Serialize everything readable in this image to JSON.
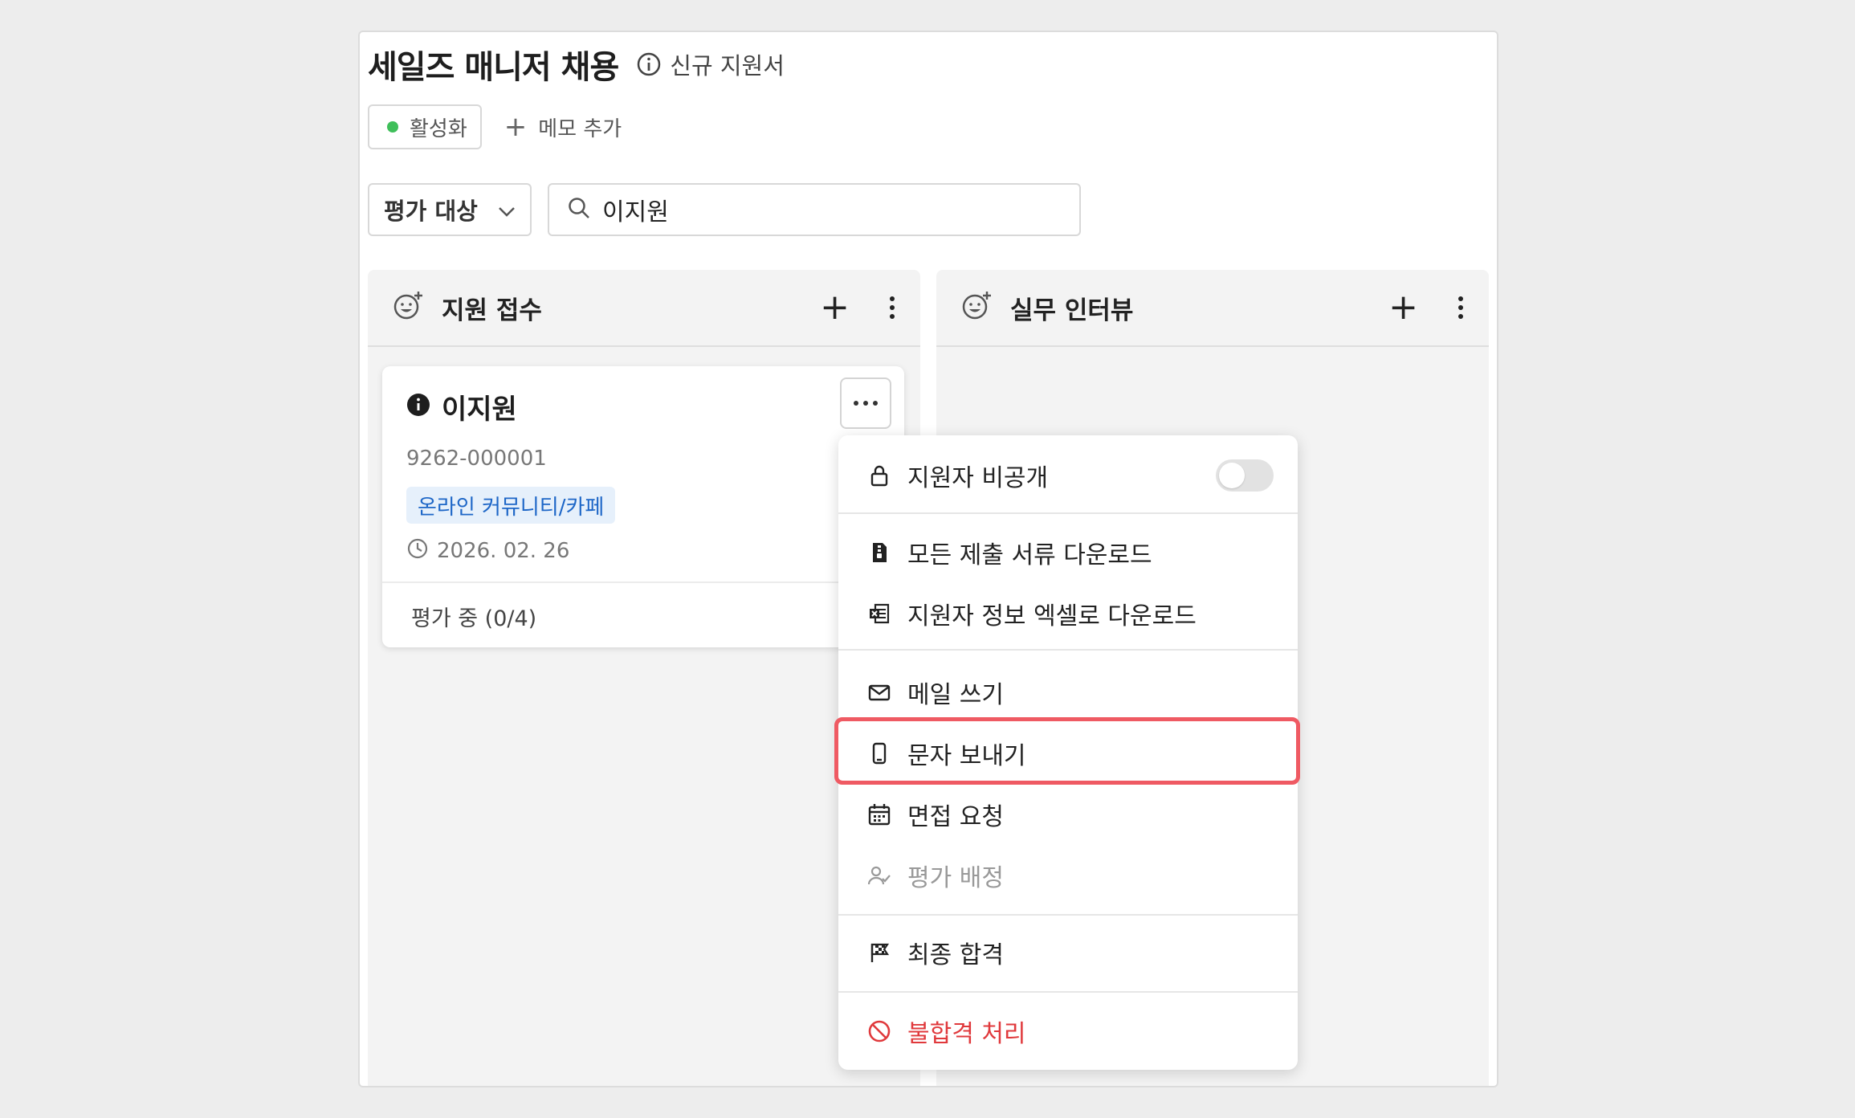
{
  "header": {
    "title": "세일즈 매니저 채용",
    "subtitle": "신규 지원서"
  },
  "status": {
    "label": "활성화",
    "color": "#3fbf5a"
  },
  "memo": {
    "label": "메모 추가"
  },
  "filter": {
    "selected": "평가 대상"
  },
  "search": {
    "value": "이지원"
  },
  "columns": [
    {
      "title": "지원 접수",
      "icon": "smile-plus-icon"
    },
    {
      "title": "실무 인터뷰",
      "icon": "smile-plus-icon"
    }
  ],
  "card": {
    "name": "이지원",
    "id": "9262-000001",
    "source": "온라인 커뮤니티/카페",
    "date": "2026. 02. 26",
    "progress": "평가 중 (0/4)"
  },
  "menu": {
    "items": [
      {
        "label": "지원자 비공개",
        "icon": "lock-icon"
      },
      {
        "label": "모든 제출 서류 다운로드",
        "icon": "file-zip-icon"
      },
      {
        "label": "지원자 정보 엑셀로 다운로드",
        "icon": "excel-icon"
      },
      {
        "label": "메일 쓰기",
        "icon": "mail-icon"
      },
      {
        "label": "문자 보내기",
        "icon": "phone-icon"
      },
      {
        "label": "면접 요청",
        "icon": "calendar-icon"
      },
      {
        "label": "평가 배정",
        "icon": "user-check-icon"
      },
      {
        "label": "최종 합격",
        "icon": "flag-icon"
      },
      {
        "label": "불합격 처리",
        "icon": "ban-icon"
      }
    ],
    "private_toggle_on": false,
    "highlight_color": "#ef5a63",
    "danger_color": "#e0393c"
  }
}
